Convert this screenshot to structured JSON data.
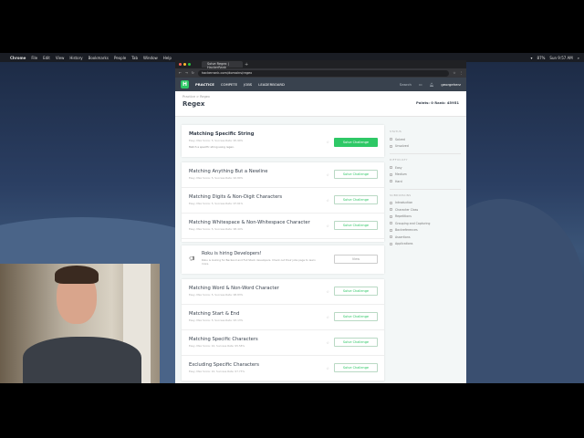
{
  "menubar": {
    "items": [
      "Chrome",
      "File",
      "Edit",
      "View",
      "History",
      "Bookmarks",
      "People",
      "Tab",
      "Window",
      "Help"
    ],
    "status": "87%",
    "clock": "Sun 9:57 AM"
  },
  "browser": {
    "tab_title": "Solve Regex | HackerRank",
    "url": "hackerrank.com/domains/regex"
  },
  "nav": {
    "logo": "H",
    "items": [
      "PRACTICE",
      "COMPETE",
      "JOBS",
      "LEADERBOARD"
    ],
    "search": "Search",
    "user": "georgeherz"
  },
  "header": {
    "breadcrumb": "Practice > Regex",
    "title": "Regex",
    "points": "Points: 0  Rank: 45951"
  },
  "featured": {
    "title": "Matching Specific String",
    "subtitle": "Easy, Max Score: 5, Success Rate: 95.90%",
    "desc": "Match a specific string using regex.",
    "button": "Solve Challenge"
  },
  "group1": [
    {
      "title": "Matching Anything But a Newline",
      "subtitle": "Easy, Max Score: 5, Success Rate: 92.80%",
      "button": "Solve Challenge"
    },
    {
      "title": "Matching Digits & Non-Digit Characters",
      "subtitle": "Easy, Max Score: 5, Success Rate: 97.61%",
      "button": "Solve Challenge"
    },
    {
      "title": "Matching Whitespace & Non-Whitespace Character",
      "subtitle": "Easy, Max Score: 5, Success Rate: 98.44%",
      "button": "Solve Challenge"
    }
  ],
  "ad": {
    "title": "Roku is hiring Developers!",
    "desc": "Roku is looking for Backend and Full Stack developers. Check out their jobs page to learn more.",
    "button": "View"
  },
  "group2": [
    {
      "title": "Matching Word & Non-Word Character",
      "subtitle": "Easy, Max Score: 5, Success Rate: 98.83%",
      "button": "Solve Challenge"
    },
    {
      "title": "Matching Start & End",
      "subtitle": "Easy, Max Score: 5, Success Rate: 93.13%",
      "button": "Solve Challenge"
    },
    {
      "title": "Matching Specific Characters",
      "subtitle": "Easy, Max Score: 10, Success Rate: 95.58%",
      "button": "Solve Challenge"
    },
    {
      "title": "Excluding Specific Characters",
      "subtitle": "Easy, Max Score: 10, Success Rate: 97.73%",
      "button": "Solve Challenge"
    }
  ],
  "sidebar": {
    "status": {
      "heading": "STATUS",
      "options": [
        "Solved",
        "Unsolved"
      ]
    },
    "difficulty": {
      "heading": "DIFFICULTY",
      "options": [
        "Easy",
        "Medium",
        "Hard"
      ]
    },
    "subdomains": {
      "heading": "SUBDOMAINS",
      "options": [
        "Introduction",
        "Character Class",
        "Repetitions",
        "Grouping and Capturing",
        "Backreferences",
        "Assertions",
        "Applications"
      ]
    }
  }
}
